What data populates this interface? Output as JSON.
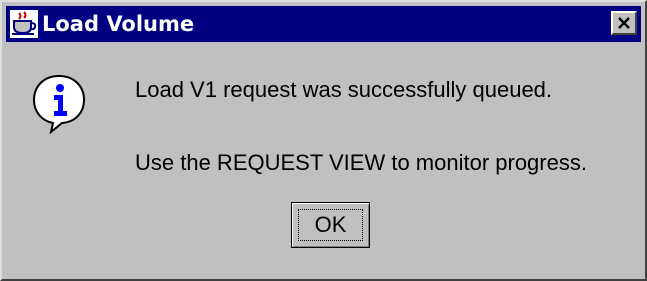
{
  "window": {
    "title": "Load Volume",
    "app_icon": "java-cup-icon",
    "close_icon": "close-icon"
  },
  "dialog": {
    "icon": "info-icon",
    "message_line1": "Load V1 request was successfully queued.",
    "message_line2": "Use the REQUEST VIEW to monitor progress.",
    "ok_label": "OK"
  },
  "colors": {
    "titlebar": "#000080",
    "face": "#c0c0c0",
    "icon_blue": "#0000ff"
  }
}
